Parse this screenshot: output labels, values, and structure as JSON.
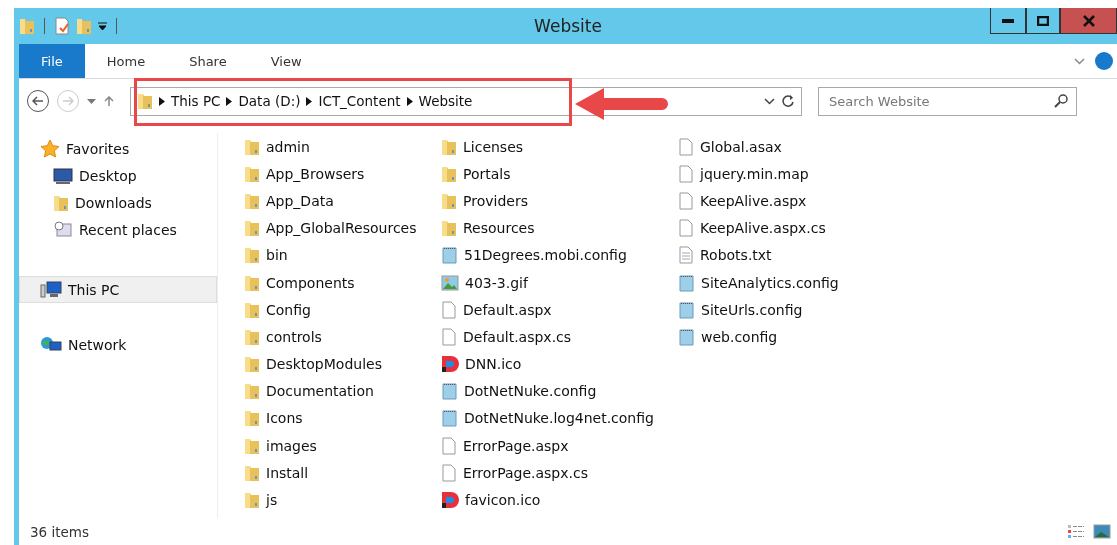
{
  "window": {
    "title": "Website"
  },
  "ribbon_tabs": [
    {
      "label": "File",
      "kind": "file"
    },
    {
      "label": "Home",
      "kind": "tab"
    },
    {
      "label": "Share",
      "kind": "tab"
    },
    {
      "label": "View",
      "kind": "tab"
    }
  ],
  "breadcrumb": [
    "This PC",
    "Data (D:)",
    "ICT_Content",
    "Website"
  ],
  "search": {
    "placeholder": "Search Website"
  },
  "sidebar": {
    "groups": [
      {
        "label": "Favorites",
        "kind": "favorites",
        "selected": false,
        "children": [
          {
            "label": "Desktop",
            "kind": "desktop"
          },
          {
            "label": "Downloads",
            "kind": "downloads"
          },
          {
            "label": "Recent places",
            "kind": "recent"
          }
        ]
      },
      {
        "label": "This PC",
        "kind": "pc",
        "selected": true
      },
      {
        "label": "Network",
        "kind": "network",
        "selected": false
      }
    ]
  },
  "files": [
    {
      "name": "admin",
      "kind": "folder"
    },
    {
      "name": "App_Browsers",
      "kind": "folder"
    },
    {
      "name": "App_Data",
      "kind": "folder"
    },
    {
      "name": "App_GlobalResources",
      "kind": "folder"
    },
    {
      "name": "bin",
      "kind": "folder"
    },
    {
      "name": "Components",
      "kind": "folder"
    },
    {
      "name": "Config",
      "kind": "folder"
    },
    {
      "name": "controls",
      "kind": "folder"
    },
    {
      "name": "DesktopModules",
      "kind": "folder"
    },
    {
      "name": "Documentation",
      "kind": "folder"
    },
    {
      "name": "Icons",
      "kind": "folder"
    },
    {
      "name": "images",
      "kind": "folder"
    },
    {
      "name": "Install",
      "kind": "folder"
    },
    {
      "name": "js",
      "kind": "folder"
    },
    {
      "name": "Licenses",
      "kind": "folder"
    },
    {
      "name": "Portals",
      "kind": "folder"
    },
    {
      "name": "Providers",
      "kind": "folder"
    },
    {
      "name": "Resources",
      "kind": "folder"
    },
    {
      "name": "51Degrees.mobi.config",
      "kind": "config"
    },
    {
      "name": "403-3.gif",
      "kind": "image"
    },
    {
      "name": "Default.aspx",
      "kind": "file"
    },
    {
      "name": "Default.aspx.cs",
      "kind": "file"
    },
    {
      "name": "DNN.ico",
      "kind": "dnn"
    },
    {
      "name": "DotNetNuke.config",
      "kind": "config"
    },
    {
      "name": "DotNetNuke.log4net.config",
      "kind": "config"
    },
    {
      "name": "ErrorPage.aspx",
      "kind": "file"
    },
    {
      "name": "ErrorPage.aspx.cs",
      "kind": "file"
    },
    {
      "name": "favicon.ico",
      "kind": "dnn"
    },
    {
      "name": "Global.asax",
      "kind": "file"
    },
    {
      "name": "jquery.min.map",
      "kind": "file"
    },
    {
      "name": "KeepAlive.aspx",
      "kind": "file"
    },
    {
      "name": "KeepAlive.aspx.cs",
      "kind": "file"
    },
    {
      "name": "Robots.txt",
      "kind": "text"
    },
    {
      "name": "SiteAnalytics.config",
      "kind": "config"
    },
    {
      "name": "SiteUrls.config",
      "kind": "config"
    },
    {
      "name": "web.config",
      "kind": "config"
    }
  ],
  "status_bar": {
    "count": "36 items"
  }
}
